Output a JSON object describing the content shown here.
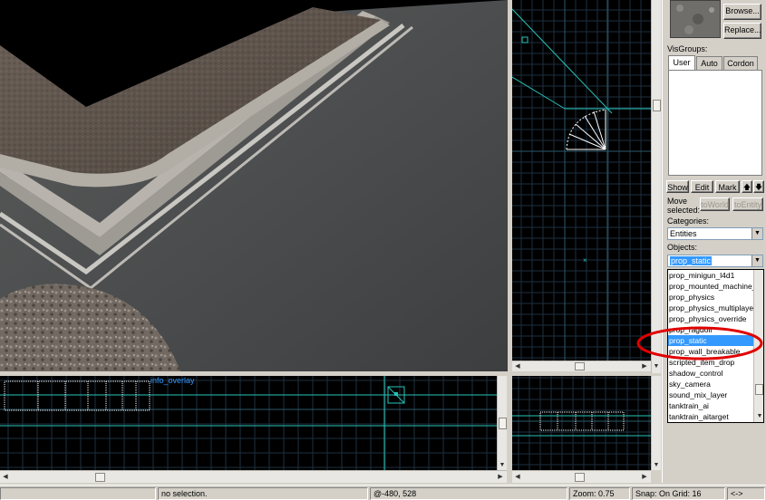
{
  "viewport_bl": {
    "entity_label": "info_overlay"
  },
  "panel": {
    "browse_label": "Browse...",
    "replace_label": "Replace...",
    "visgroups_label": "VisGroups:",
    "tabs": [
      "User",
      "Auto",
      "Cordon"
    ],
    "show_label": "Show",
    "edit_label": "Edit",
    "mark_label": "Mark",
    "up_arrow": "🡅",
    "down_arrow": "🡇",
    "move_selected_label": "Move selected:",
    "toworld_label": "toWorld",
    "toentity_label": "toEntity",
    "categories_label": "Categories:",
    "categories_value": "Entities",
    "objects_label": "Objects:",
    "objects_value": "prop_static",
    "object_items": [
      "prop_minigun_l4d1",
      "prop_mounted_machine_g",
      "prop_physics",
      "prop_physics_multiplayer",
      "prop_physics_override",
      "prop_ragdoll",
      "prop_static",
      "prop_wall_breakable",
      "scripted_item_drop",
      "shadow_control",
      "sky_camera",
      "sound_mix_layer",
      "tanktrain_ai",
      "tanktrain_aitarget"
    ],
    "selected_item": "prop_static"
  },
  "status": {
    "selection": "no selection.",
    "coords": "@-480, 528",
    "zoom": "Zoom: 0.75",
    "snap": "Snap: On Grid: 16",
    "arrows": "<->"
  },
  "colors": {
    "grid_line": "#1e2f3f",
    "grid_major": "#2d5a6a",
    "cyan": "#27c3b8",
    "selection_blue": "#3399ff",
    "annotation_red": "#e00000"
  }
}
